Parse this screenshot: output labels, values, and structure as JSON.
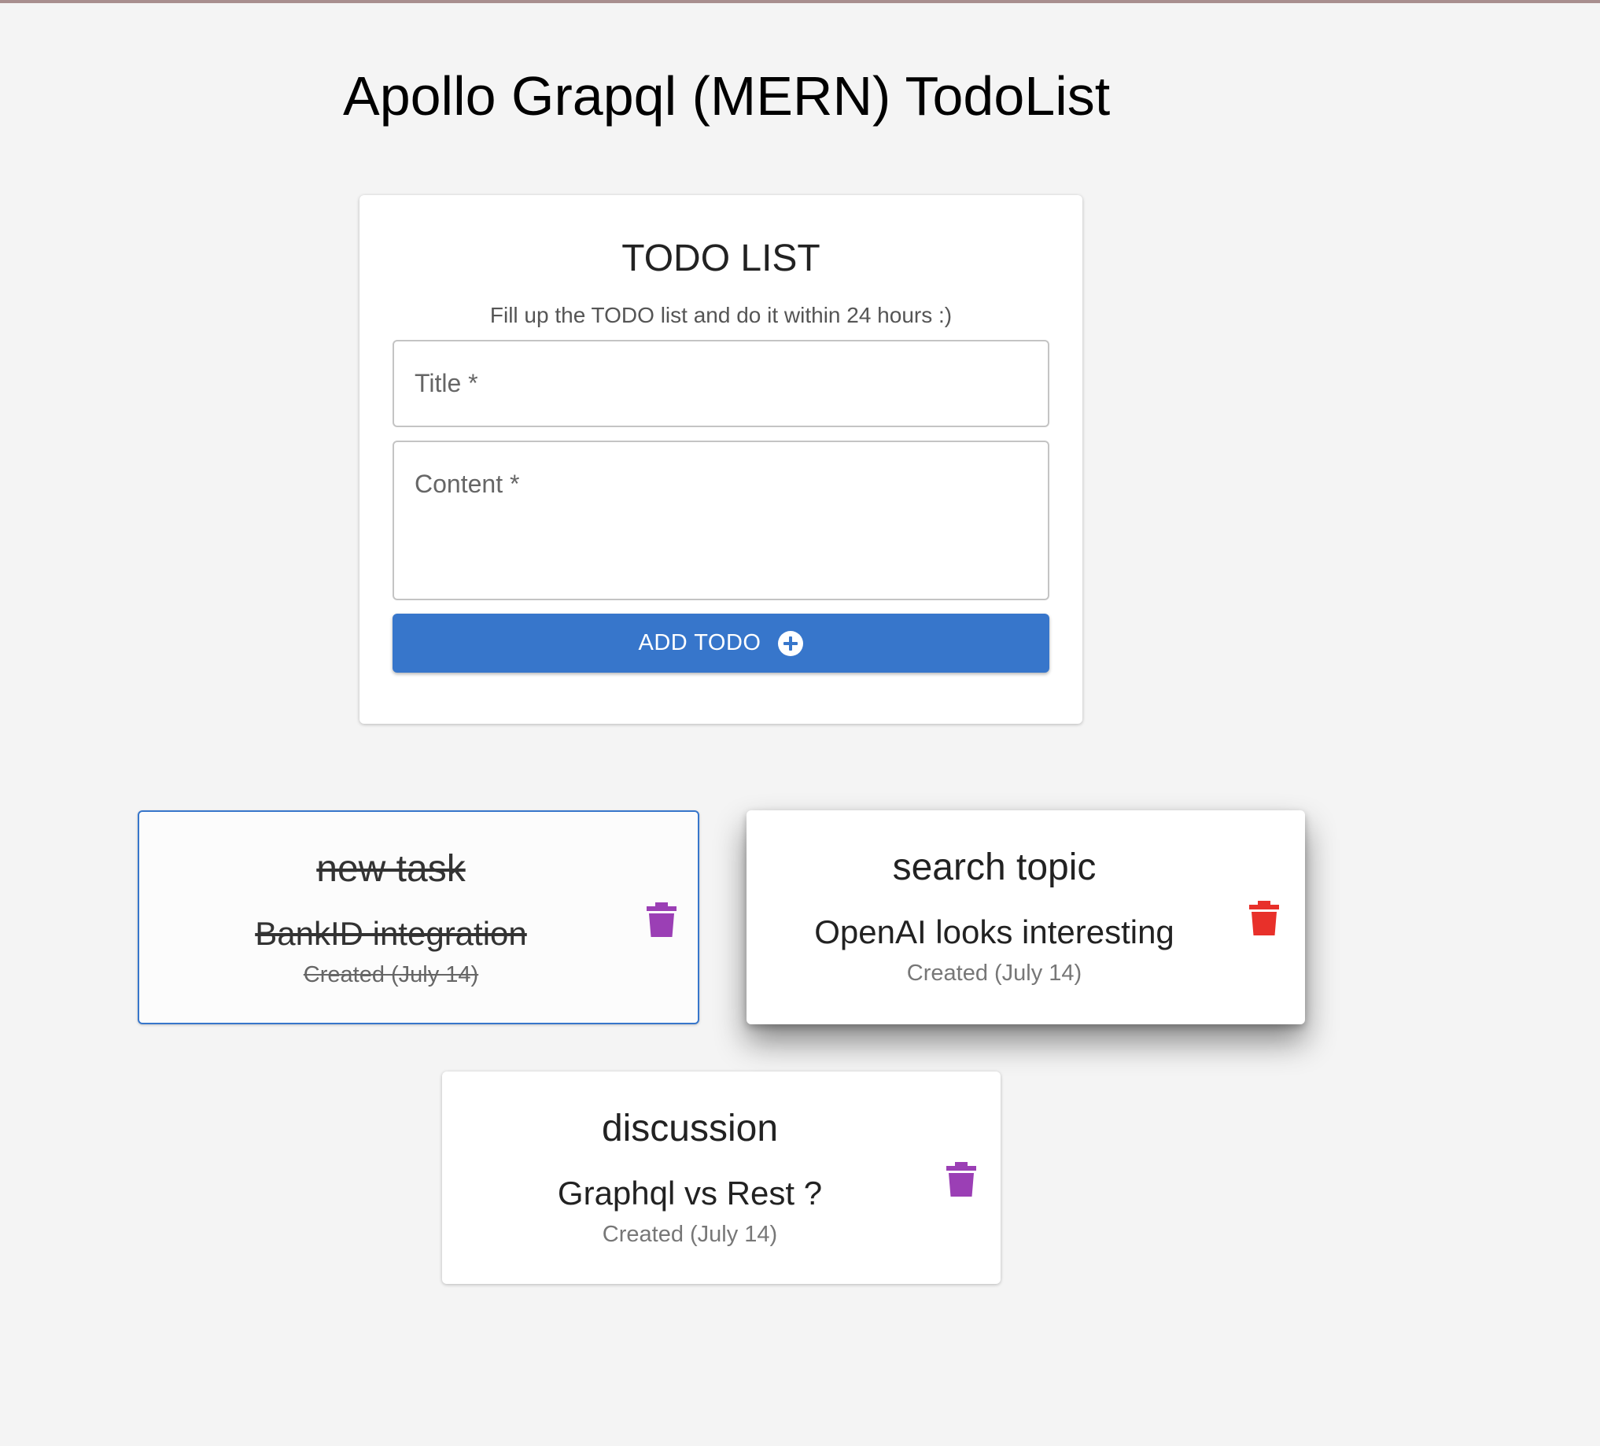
{
  "page": {
    "title": "Apollo Grapql (MERN) TodoList"
  },
  "form": {
    "heading": "TODO LIST",
    "subheading": "Fill up the TODO list and do it within 24 hours :)",
    "title_label": "Title *",
    "content_label": "Content *",
    "add_label": "ADD TODO",
    "add_icon": "plus-circle-icon",
    "accent_color": "#3776cb"
  },
  "todos": [
    {
      "title": "new task",
      "content": "BankID integration",
      "created": "Created (July 14)",
      "completed": true,
      "state": "selected",
      "delete_icon": "trash-icon",
      "delete_color": "#9b3fb5"
    },
    {
      "title": "search topic",
      "content": "OpenAI looks interesting",
      "created": "Created (July 14)",
      "completed": false,
      "state": "hovered",
      "delete_icon": "trash-icon",
      "delete_color": "#e8302a"
    },
    {
      "title": "discussion",
      "content": "Graphql vs Rest ?",
      "created": "Created (July 14)",
      "completed": false,
      "state": "default",
      "delete_icon": "trash-icon",
      "delete_color": "#9b3fb5"
    }
  ]
}
